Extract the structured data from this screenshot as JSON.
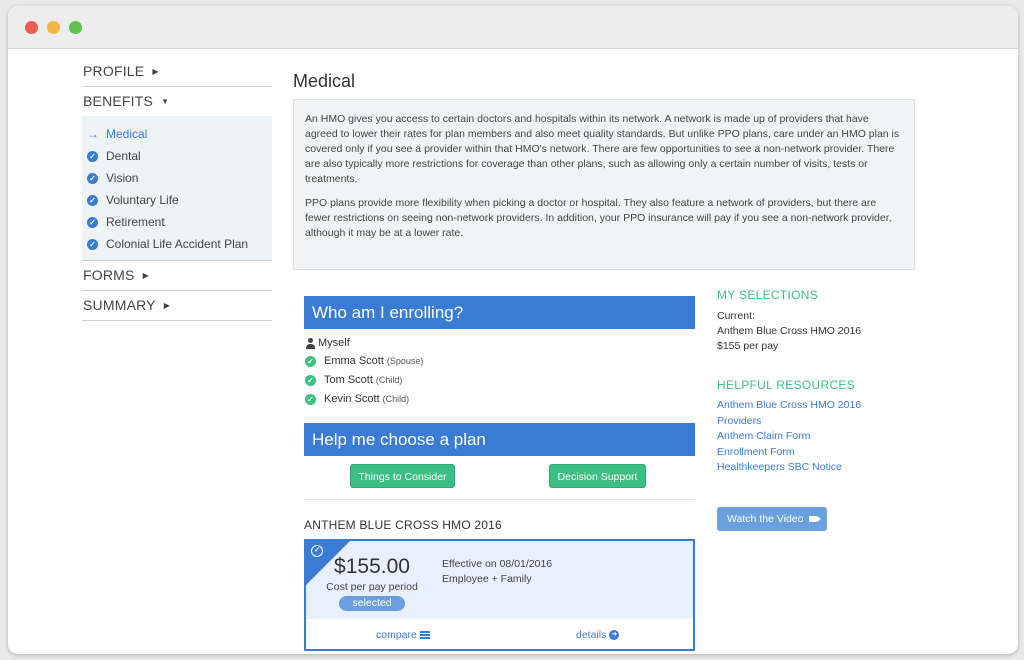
{
  "sidebar": {
    "profile": "PROFILE",
    "benefits": "BENEFITS",
    "forms": "FORMS",
    "summary": "SUMMARY",
    "items": [
      "Medical",
      "Dental",
      "Vision",
      "Voluntary Life",
      "Retirement",
      "Colonial Life Accident Plan"
    ]
  },
  "main": {
    "title": "Medical",
    "info_p1": "An HMO gives you access to certain doctors and hospitals within its network. A network is made up of providers that have agreed to lower their rates for plan members and also meet quality standards. But unlike PPO plans, care under an HMO plan is covered only if you see a provider within that HMO's network. There are few opportunities to see a non-network provider. There are also typically more restrictions for coverage than other plans, such as allowing only a certain number of visits, tests or treatments.",
    "info_p2": "PPO plans provide more flexibility when picking a doctor or hospital. They also feature a network of providers, but there are fewer restrictions on seeing non-network providers. In addition, your PPO insurance will pay if you see a non-network provider, although it may be at a lower rate."
  },
  "enroll": {
    "heading": "Who am I enrolling?",
    "myself": "Myself",
    "members": [
      {
        "name": "Emma Scott",
        "rel": "(Spouse)"
      },
      {
        "name": "Tom Scott",
        "rel": "(Child)"
      },
      {
        "name": "Kevin Scott",
        "rel": "(Child)"
      }
    ]
  },
  "help": {
    "heading": "Help me choose a plan",
    "consider_btn": "Things to Consider",
    "decision_btn": "Decision Support"
  },
  "plan": {
    "name": "ANTHEM BLUE CROSS HMO 2016",
    "price": "$155.00",
    "cost_label": "Cost per pay period",
    "selected": "selected",
    "effective": "Effective on 08/01/2016",
    "coverage": "Employee + Family",
    "compare": "compare",
    "details": "details"
  },
  "selections": {
    "heading": "MY SELECTIONS",
    "current_label": "Current:",
    "current_plan": "Anthem Blue Cross HMO 2016",
    "current_cost": "$155 per pay"
  },
  "resources": {
    "heading": "HELPFUL RESOURCES",
    "links": [
      "Anthem Blue Cross HMO 2016",
      "Providers",
      "Anthem Claim Form",
      "Enrollment Form",
      "Healthkeepers SBC Notice"
    ]
  },
  "video_btn": "Watch the Video",
  "colors": {
    "accent": "#3a7bd5",
    "green": "#3bbf82",
    "panel": "#f1f4f5"
  }
}
